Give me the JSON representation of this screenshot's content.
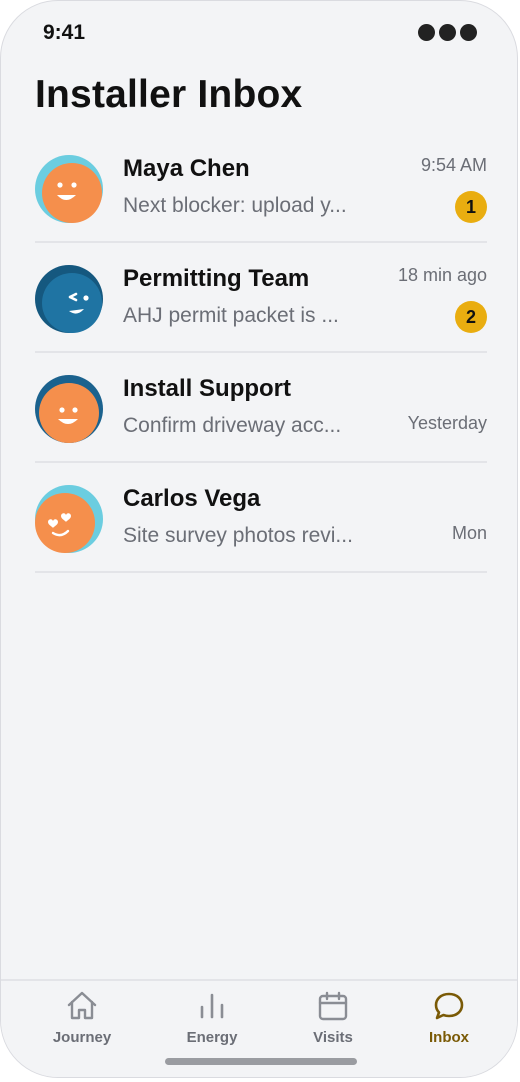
{
  "status_bar": {
    "time": "9:41"
  },
  "header": {
    "title": "Installer Inbox"
  },
  "threads": [
    {
      "name": "Maya Chen",
      "preview": "Next blocker: upload y...",
      "time": "9:54 AM",
      "unread": "1",
      "avatar": "smiling-face-avatar"
    },
    {
      "name": "Permitting Team",
      "preview": "AHJ permit packet is ...",
      "time": "18 min ago",
      "unread": "2",
      "avatar": "winking-face-avatar"
    },
    {
      "name": "Install Support",
      "preview": "Confirm driveway acc...",
      "time": "Yesterday",
      "unread": "",
      "avatar": "smiling-face-avatar"
    },
    {
      "name": "Carlos Vega",
      "preview": "Site survey photos revi...",
      "time": "Mon",
      "unread": "",
      "avatar": "heart-eyes-face-avatar"
    }
  ],
  "tabbar": {
    "tabs": [
      {
        "label": "Journey",
        "icon": "home-icon",
        "active": false
      },
      {
        "label": "Energy",
        "icon": "bar-chart-icon",
        "active": false
      },
      {
        "label": "Visits",
        "icon": "calendar-icon",
        "active": false
      },
      {
        "label": "Inbox",
        "icon": "chat-bubble-icon",
        "active": true
      }
    ]
  },
  "colors": {
    "accent": "#e9ad10",
    "active_tab": "#7a5a06",
    "avatar_orange": "#f58f4c",
    "avatar_sky": "#6bcde0",
    "avatar_navy": "#1b628e",
    "background": "#f3f4f6"
  }
}
